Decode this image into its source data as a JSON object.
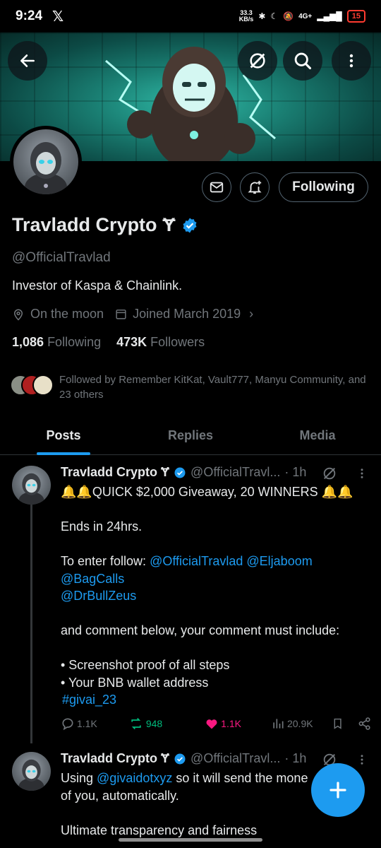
{
  "status_bar": {
    "time": "9:24",
    "speed_top": "33.3",
    "speed_bottom": "KB/s",
    "network": "4G+",
    "battery": "15"
  },
  "profile": {
    "name": "Travladd Crypto",
    "name_suffix": "Ɏ",
    "handle": "@OfficialTravlad",
    "bio": "Investor of Kaspa & Chainlink.",
    "location": "On the moon",
    "joined": "Joined March 2019",
    "following_count": "1,086",
    "following_label": "Following",
    "followers_count": "473K",
    "followers_label": "Followers",
    "followed_by": "Followed by Remember KitKat, Vault777, Manyu Community, and 23 others",
    "follow_button_label": "Following"
  },
  "tabs": [
    "Posts",
    "Replies",
    "Media"
  ],
  "tweets": [
    {
      "name": "Travladd Crypto Ɏ",
      "handle": "@OfficialTravl...",
      "time": "· 1h",
      "line1": "🔔🔔QUICK $2,000 Giveaway, 20 WINNERS 🔔🔔",
      "line2": "Ends in 24hrs.",
      "line3_prefix": "To enter follow: ",
      "mention1": "@OfficialTravlad",
      "mention2": "@Eljaboom",
      "mention3": "@BagCalls",
      "mention4": "@DrBullZeus",
      "line4": "and comment below, your comment must include:",
      "bullet1": "• Screenshot proof of all steps",
      "bullet2": "• Your BNB wallet address",
      "hashtag": "#givai_23",
      "replies": "1.1K",
      "reposts": "948",
      "likes": "1.1K",
      "views": "20.9K"
    },
    {
      "name": "Travladd Crypto Ɏ",
      "handle": "@OfficialTravl...",
      "time": "· 1h",
      "line1_prefix": "Using ",
      "mention": "@givaidotxyz",
      "line1_suffix": " so it will send the mone",
      "line2": "of you, automatically.",
      "line3": "Ultimate transparency and fairness"
    }
  ],
  "colors": {
    "accent": "#1d9bf0",
    "like": "#f91880",
    "repost": "#00ba7c",
    "muted": "#71767b"
  }
}
